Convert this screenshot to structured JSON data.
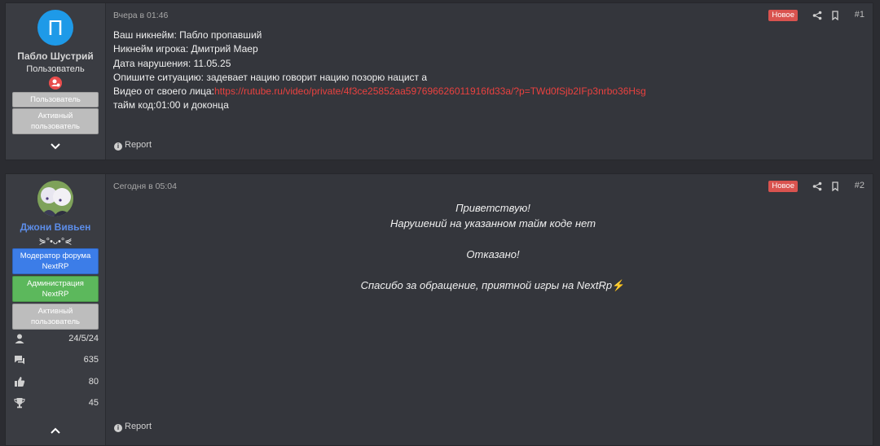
{
  "post1": {
    "author": {
      "avatar_letter": "П",
      "name": "Пабло Шустрий",
      "title": "Пользователь",
      "badge_icon": "user-badge-icon",
      "banners": [
        "Пользователь",
        "Активный пользователь"
      ],
      "toggle_icon": "chevron-down-icon"
    },
    "date": "Вчера в 01:46",
    "new_label": "Новое",
    "number": "#1",
    "lines": [
      "Ваш никнейм: Пабло пропавший",
      "Никнейм игрока: Дмитрий Маер",
      "Дата нарушения: 11.05.25",
      "Опишите ситуацию: задевает нацию говорит нацию позорю нацист а"
    ],
    "video_label": "Видео от своего лица:",
    "video_link": "https://rutube.ru/video/private/4f3ce25852aa597696626011916fd33a/?p=TWd0fSjb2IFp3nrbo36Hsg",
    "timecode": "тайм код:01:00 и доконца",
    "report_label": "Report"
  },
  "post2": {
    "author": {
      "name": "Джони Вивьен",
      "title": "⋟°•ᴗ•°⋞",
      "banners": [
        "Модератор форума NextRP",
        "Администрация NextRP",
        "Активный пользователь"
      ],
      "stats": [
        {
          "icon": "user-icon",
          "value": "24/5/24"
        },
        {
          "icon": "messages-icon",
          "value": "635"
        },
        {
          "icon": "thumbs-up-icon",
          "value": "80"
        },
        {
          "icon": "trophy-icon",
          "value": "45"
        }
      ],
      "toggle_icon": "chevron-up-icon"
    },
    "date": "Сегодня в 05:04",
    "new_label": "Новое",
    "number": "#2",
    "greeting": "Приветствую!",
    "line1": "Нарушений на указанном тайм коде нет",
    "verdict": "Отказано!",
    "thanks": "Спасибо за обращение, приятной игры на NextRp",
    "thanks_emoji": "⚡",
    "report_label": "Report"
  },
  "colors": {
    "background": "#2b2c31",
    "post_bg": "#34363c",
    "new_badge": "#d9534f",
    "link": "#e9413f",
    "moderator_name": "#5c8de8"
  }
}
